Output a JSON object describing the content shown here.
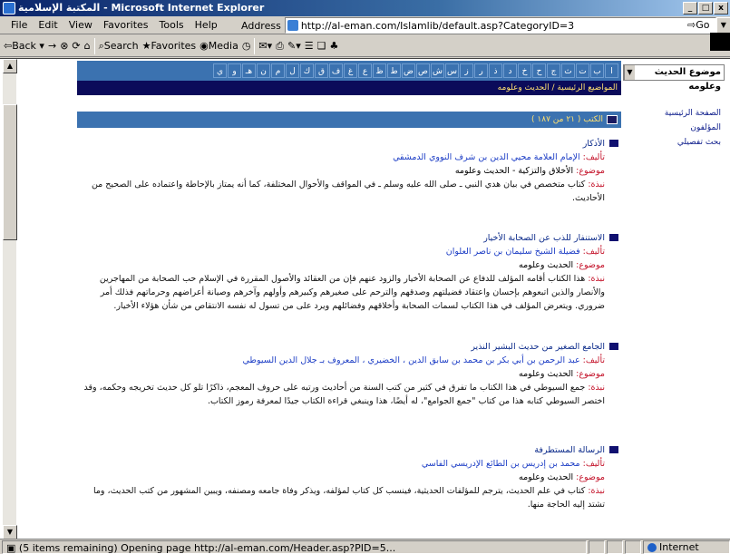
{
  "window": {
    "title": "المكتبة الإسلامية - Microsoft Internet Explorer",
    "controls": [
      "_",
      "□",
      "x"
    ]
  },
  "menu": [
    "File",
    "Edit",
    "View",
    "Favorites",
    "Tools",
    "Help"
  ],
  "address": {
    "label": "Address",
    "url": "http://al-eman.com/Islamlib/default.asp?CategoryID=3",
    "go_label": "Go"
  },
  "toolbar": {
    "back": "Back",
    "forward": "→",
    "search": "Search",
    "favorites": "Favorites",
    "media": "Media"
  },
  "page": {
    "topic_select": "موضوع الحديث وعلومه",
    "right_links": [
      "الصفحة الرئيسية",
      "المؤلفون",
      "بحث تفصيلي"
    ],
    "letters": [
      "ا",
      "ب",
      "ت",
      "ث",
      "ج",
      "ح",
      "خ",
      "د",
      "ذ",
      "ر",
      "ز",
      "س",
      "ش",
      "ص",
      "ض",
      "ط",
      "ظ",
      "ع",
      "غ",
      "ف",
      "ق",
      "ك",
      "ل",
      "م",
      "ن",
      "هـ",
      "و",
      "ي"
    ],
    "breadcrumb": "المواضيع الرئيسية / الحديث وعلومه",
    "books_bar": "الكتب ( ٢١ من ١٨٧ )",
    "labels": {
      "author": "تأليف:",
      "topic": "موضوع:",
      "summary": "نبذة:"
    },
    "books": [
      {
        "title": "الأذكار",
        "author": "الإمام العلامة محيي الدين بن شرف النووي الدمشقي",
        "topic": "الأخلاق والتزكية  -  الحديث وعلومه",
        "summary": "كتاب متخصص في بيان هدي النبي ـ صلى الله عليه وسلم ـ في المواقف والأحوال المختلفة، كما أنه يمتاز بالإحاطة واعتماده على الصحيح من الأحاديث."
      },
      {
        "title": "الاستنفار للذب عن الصحابة الأخيار",
        "author": "فضيلة الشيخ سليمان بن ناصر العلوان",
        "topic": "الحديث وعلومه",
        "summary": "هذا الكتاب أقامه المؤلف للدفاع عن الصحابة الأخيار والزود عنهم فإن من العقائد والأصول المقررة في الإسلام حب الصحابة من المهاجرين والأنصار والذين اتبعوهم بإحسان واعتقاد فضيلتهم وصدقهم والترحم على صغيرهم وكبيرهم وأولهم وآخرهم وصيانة أعراضهم وحرماتهم فذلك أمر ضروري. ويتعرض المؤلف في هذا الكتاب لسمات الصحابة وأخلاقهم وفضائلهم ويرد على من تسول له نفسه الانتقاص من شأن هؤلاء الأخيار."
      },
      {
        "title": "الجامع الصغير من حديث البشير النذير",
        "author": "عبد الرحمن بن أبي بكر بن محمد بن سابق الدين ، الخضيري ، المعروف بـ جلال الدين السيوطي",
        "topic": "الحديث وعلومه",
        "summary": "جمع السيوطي في هذا الكتاب ما تفرق في كثير من كتب السنة من أحاديث ورتبه على حروف المعجم، ذاكرًا تلو كل حديث تخريجه وحكمه، وقد اختصر السيوطي كتابه هذا من كتاب \"جمع الجوامع\"، له أيضًا، هذا وينبغي قراءة الكتاب جيدًا لمعرفة رموز الكتاب."
      },
      {
        "title": "الرسالة المستطرفة",
        "author": "محمد بن إدريس بن الطائع الإدريسي الفاسي",
        "topic": "الحديث وعلومه",
        "summary": "كتاب في علم الحديث، يترجم للمؤلفات الحديثية، فينسب كل كتاب لمؤلفه، ويذكر وفاة جامعه ومصنفه، ويبين المشهور من كتب الحديث، وما تشتد إليه الحاجة منها."
      }
    ]
  },
  "status": {
    "message": "(5 items remaining) Opening page http://al-eman.com/Header.asp?PID=5...",
    "zone": "Internet"
  }
}
